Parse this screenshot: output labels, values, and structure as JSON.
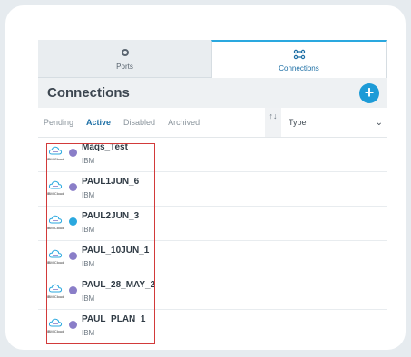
{
  "tabs": [
    {
      "label": "Ports",
      "icon": "ports-circle-icon"
    },
    {
      "label": "Connections",
      "icon": "connections-icon"
    }
  ],
  "header": {
    "title": "Connections",
    "add_button": "+"
  },
  "filters": [
    "Pending",
    "Active",
    "Disabled",
    "Archived"
  ],
  "sort": {
    "glyph": "↑↓"
  },
  "type_select": {
    "label": "Type",
    "chevron": "⌄"
  },
  "logo_text": "IBM Cloud",
  "connections": [
    {
      "name": "Maqs_Test",
      "provider": "IBM",
      "badge_color": "#8a7ec8"
    },
    {
      "name": "PAUL1JUN_6",
      "provider": "IBM",
      "badge_color": "#8a7ec8"
    },
    {
      "name": "PAUL2JUN_3",
      "provider": "IBM",
      "badge_color": "#2aa8df"
    },
    {
      "name": "PAUL_10JUN_1",
      "provider": "IBM",
      "badge_color": "#8a7ec8"
    },
    {
      "name": "PAUL_28_MAY_2",
      "provider": "IBM",
      "badge_color": "#8a7ec8"
    },
    {
      "name": "PAUL_PLAN_1",
      "provider": "IBM",
      "badge_color": "#8a7ec8"
    }
  ],
  "colors": {
    "accent": "#1d9bd7",
    "highlight": "#d23a3a"
  }
}
